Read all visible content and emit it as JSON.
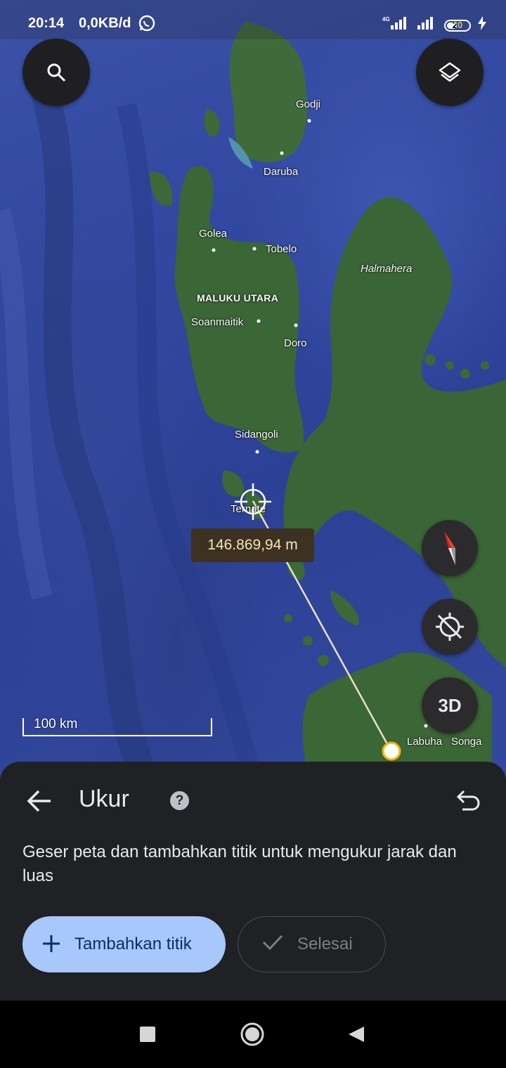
{
  "status_bar": {
    "time": "20:14",
    "speed": "0,0KB/d",
    "network": "4G",
    "battery": "20"
  },
  "map": {
    "labels": {
      "godji": "Godji",
      "daruba": "Daruba",
      "golea": "Golea",
      "tobelo": "Tobelo",
      "halmahera": "Halmahera",
      "maluku_utara": "MALUKU UTARA",
      "soanmaitik": "Soanmaitik",
      "doro": "Doro",
      "sidangoli": "Sidangoli",
      "ternate": "Ternate",
      "labuha": "Labuha",
      "songa": "Songa"
    },
    "distance": "146.869,94 m",
    "scale": "100 km",
    "btn_3d": "3D",
    "icons": {
      "search": "search-icon",
      "layers": "layers-icon",
      "compass": "compass-icon",
      "location": "location-off-icon"
    }
  },
  "sheet": {
    "title": "Ukur",
    "help": "?",
    "description": "Geser peta dan tambahkan titik untuk mengukur jarak dan luas",
    "add_point": "Tambahkan titik",
    "done": "Selesai"
  },
  "colors": {
    "accent": "#a8c7fa",
    "sheet_bg": "#202124",
    "measure_label_bg": "#3d3222",
    "point_color": "#f4b400"
  }
}
